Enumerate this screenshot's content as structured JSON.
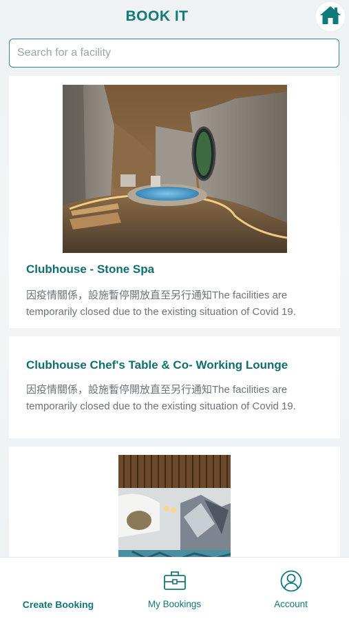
{
  "header": {
    "title": "BOOK IT",
    "home_icon": "home-icon"
  },
  "search": {
    "placeholder": "Search for a facility",
    "value": ""
  },
  "facilities": [
    {
      "name": "Clubhouse - Stone Spa",
      "description": "因疫情關係，設施暫停開放直至另行通知The facilities are temporarily closed due to the existing situation of Covid 19."
    },
    {
      "name": "Clubhouse Chef's Table & Co- Working Lounge",
      "description": "因疫情關係，設施暫停開放直至另行通知The facilities are temporarily closed due to the existing situation of Covid 19."
    }
  ],
  "tabs": [
    {
      "label": "Create Booking",
      "icon": ""
    },
    {
      "label": "My Bookings",
      "icon": "briefcase-icon"
    },
    {
      "label": "Account",
      "icon": "user-circle-icon"
    }
  ],
  "colors": {
    "accent": "#0e7b7a",
    "text_muted": "#6d7378",
    "border": "#2f8c8a"
  }
}
